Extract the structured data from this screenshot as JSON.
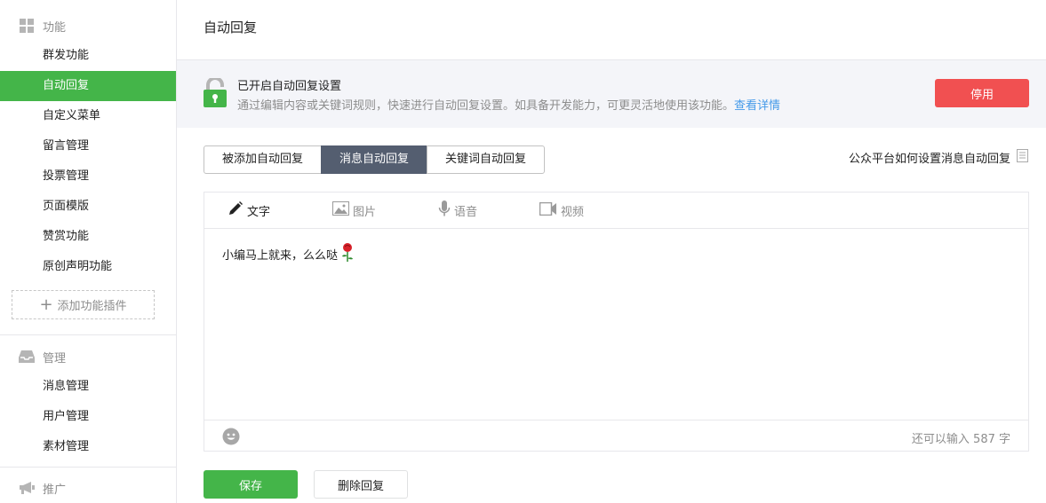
{
  "sidebar": {
    "sections": [
      {
        "title": "功能",
        "icon": "grid-icon"
      },
      {
        "title": "管理",
        "icon": "inbox-icon"
      },
      {
        "title": "推广",
        "icon": "megaphone-icon"
      }
    ],
    "feature_items": [
      {
        "label": "群发功能"
      },
      {
        "label": "自动回复",
        "active": true
      },
      {
        "label": "自定义菜单"
      },
      {
        "label": "留言管理"
      },
      {
        "label": "投票管理"
      },
      {
        "label": "页面模版"
      },
      {
        "label": "赞赏功能"
      },
      {
        "label": "原创声明功能"
      }
    ],
    "add_plugin_label": "添加功能插件",
    "manage_items": [
      {
        "label": "消息管理"
      },
      {
        "label": "用户管理"
      },
      {
        "label": "素材管理"
      }
    ]
  },
  "main": {
    "page_title": "自动回复",
    "notice": {
      "title": "已开启自动回复设置",
      "description": "通过编辑内容或关键词规则，快速进行自动回复设置。如具备开发能力，可更灵活地使用该功能。",
      "link": "查看详情",
      "disable_button": "停用",
      "icon": "lock-open-icon"
    },
    "tabs": [
      {
        "label": "被添加自动回复"
      },
      {
        "label": "消息自动回复",
        "active": true
      },
      {
        "label": "关键词自动回复"
      }
    ],
    "help_link": "公众平台如何设置消息自动回复",
    "editor": {
      "tabs": [
        {
          "label": "文字",
          "icon": "pencil-icon",
          "active": true
        },
        {
          "label": "图片",
          "icon": "image-icon"
        },
        {
          "label": "语音",
          "icon": "microphone-icon"
        },
        {
          "label": "视频",
          "icon": "video-icon"
        }
      ],
      "content": "小编马上就来，么么哒",
      "content_emoji": "rose-emoji",
      "remaining": "还可以输入 587 字"
    },
    "save_button": "保存",
    "delete_button": "删除回复"
  },
  "colors": {
    "brand_green": "#44b549",
    "danger_red": "#f15051",
    "tab_active": "#545e70",
    "link_blue": "#459ae9"
  }
}
